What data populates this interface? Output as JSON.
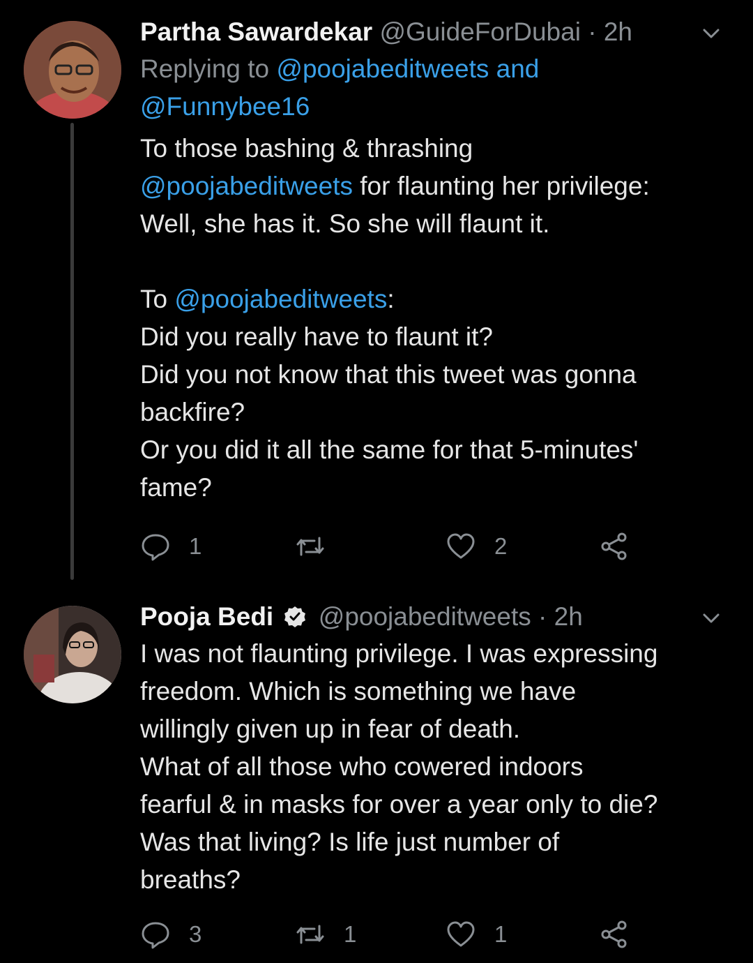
{
  "tweets": [
    {
      "author": "Partha Sawardekar",
      "handle": "@GuideForDubai",
      "separator": "·",
      "time": "2h",
      "replying_prefix": "Replying to",
      "replying_mention1": "@poojabeditweets",
      "replying_and": "and",
      "replying_mention2": "@Funnybee16",
      "text_1": "To those bashing & thrashing",
      "text_mention1": "@poojabeditweets",
      "text_2": " for flaunting her privilege:",
      "text_3": "Well, she has it. So she will flaunt it.",
      "text_4": "To ",
      "text_mention2": "@poojabeditweets",
      "text_5": ":",
      "text_6": "Did you really have to flaunt it?",
      "text_7": "Did you not know that this tweet was gonna",
      "text_8": "backfire?",
      "text_9": "Or you did it all the same for that 5-minutes'",
      "text_10": "fame?",
      "reply_count": "1",
      "retweet_count": "",
      "like_count": "2"
    },
    {
      "author": "Pooja Bedi",
      "handle": "@poojabeditweets",
      "separator": "·",
      "time": "2h",
      "verified": true,
      "lines": [
        "I was not flaunting privilege. I was expressing",
        "freedom. Which is something we have",
        "willingly given up in fear of death.",
        "What of all those who cowered indoors",
        "fearful & in masks for over a year only to die?",
        "Was that living? Is life just number of",
        "breaths?"
      ],
      "reply_count": "3",
      "retweet_count": "1",
      "like_count": "1"
    }
  ],
  "icons": {
    "reply": "speech-bubble-icon",
    "retweet": "retweet-icon",
    "like": "heart-icon",
    "share": "share-icon",
    "menu": "chevron-down-icon",
    "verified": "verified-badge-icon"
  },
  "colors": {
    "background": "#000000",
    "text": "#e6e6e6",
    "muted": "#8a8f94",
    "link": "#3aa0e8"
  }
}
